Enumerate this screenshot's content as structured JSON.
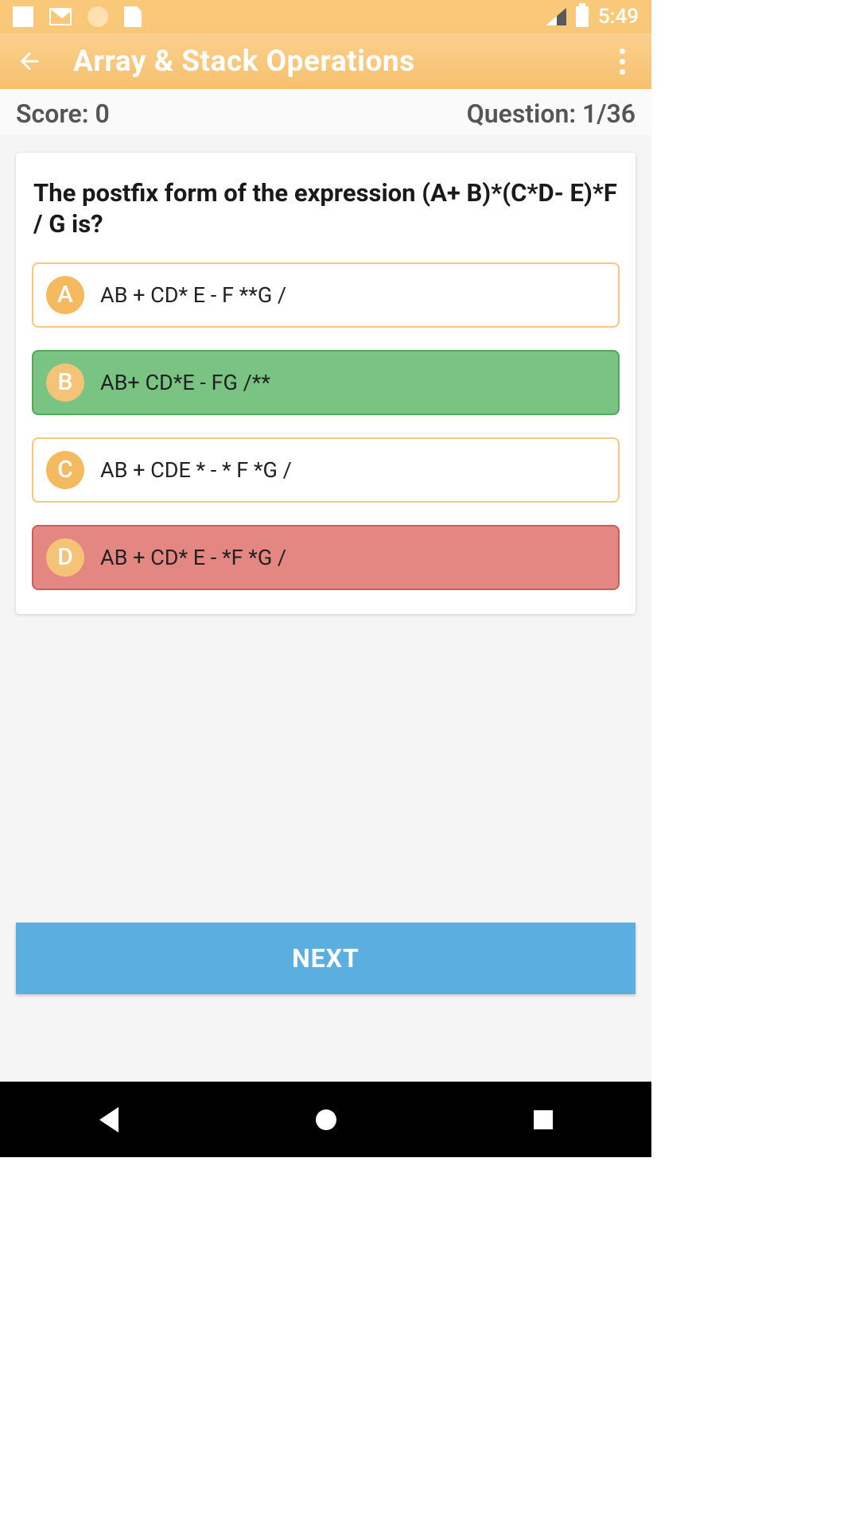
{
  "status": {
    "time": "5:49"
  },
  "header": {
    "title": "Array & Stack Operations"
  },
  "subheader": {
    "score_label": "Score: 0",
    "question_label": "Question: 1/36"
  },
  "question": "The postfix form of the expression (A+ B)*(C*D- E)*F / G is?",
  "options": {
    "a": {
      "letter": "A",
      "text": "AB + CD* E - F **G /",
      "state": "normal"
    },
    "b": {
      "letter": "B",
      "text": "AB+ CD*E - FG /**",
      "state": "correct"
    },
    "c": {
      "letter": "C",
      "text": "AB + CDE * - * F *G /",
      "state": "normal"
    },
    "d": {
      "letter": "D",
      "text": "AB + CD* E - *F *G /",
      "state": "wrong"
    }
  },
  "next_label": "NEXT"
}
